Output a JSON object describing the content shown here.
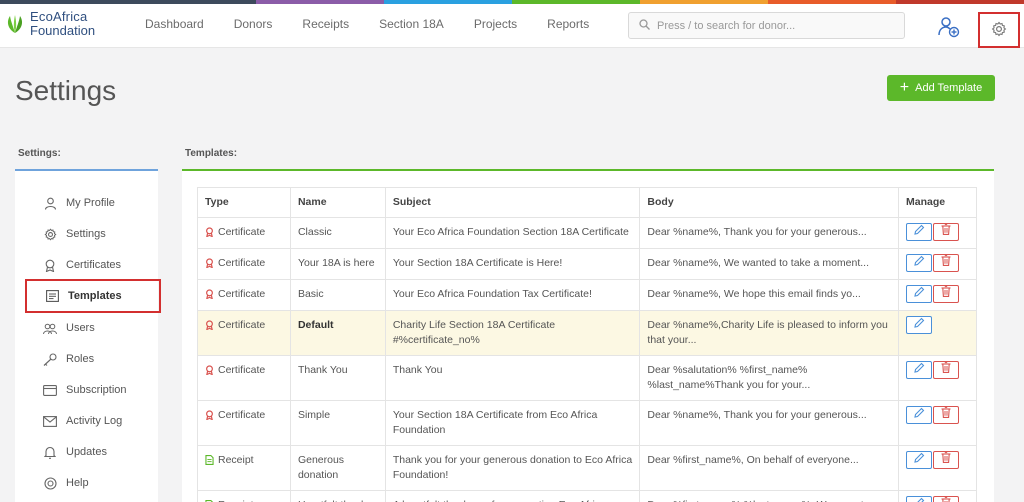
{
  "brand": {
    "line1": "EcoAfrica",
    "line2": "Foundation",
    "stripe_colors": [
      "#3d4a5c",
      "#8b5ca8",
      "#2aa0e0",
      "#5cb82a",
      "#f0a030",
      "#e85c2a",
      "#c0392b"
    ]
  },
  "nav": [
    "Dashboard",
    "Donors",
    "Receipts",
    "Section 18A",
    "Projects",
    "Reports"
  ],
  "search": {
    "placeholder": "Press / to search for donor..."
  },
  "page": {
    "title": "Settings",
    "add_button": "Add Template"
  },
  "sidebar": {
    "heading": "Settings:",
    "items": [
      {
        "label": "My Profile",
        "icon": "user-icon"
      },
      {
        "label": "Settings",
        "icon": "gear-icon"
      },
      {
        "label": "Certificates",
        "icon": "ribbon-icon"
      },
      {
        "label": "Templates",
        "icon": "template-icon"
      },
      {
        "label": "Users",
        "icon": "users-icon"
      },
      {
        "label": "Roles",
        "icon": "key-icon"
      },
      {
        "label": "Subscription",
        "icon": "card-icon"
      },
      {
        "label": "Activity Log",
        "icon": "mail-icon"
      },
      {
        "label": "Updates",
        "icon": "bell-icon"
      },
      {
        "label": "Help",
        "icon": "lifebuoy-icon"
      }
    ]
  },
  "templates": {
    "heading": "Templates:",
    "columns": [
      "Type",
      "Name",
      "Subject",
      "Body",
      "Manage"
    ],
    "rows": [
      {
        "type": "Certificate",
        "name": "Classic",
        "subject": "Your Eco Africa Foundation Section 18A Certificate",
        "body": "Dear %name%, Thank you for your generous...",
        "deletable": true
      },
      {
        "type": "Certificate",
        "name": "Your 18A is here",
        "subject": "Your Section 18A Certificate is Here!",
        "body": "Dear %name%, We wanted to take a moment...",
        "deletable": true
      },
      {
        "type": "Certificate",
        "name": "Basic",
        "subject": "Your Eco Africa Foundation Tax Certificate!",
        "body": "Dear %name%, We hope this email finds yo...",
        "deletable": true
      },
      {
        "type": "Certificate",
        "name": "Default",
        "subject": "Charity Life Section 18A Certificate #%certificate_no%",
        "body": "Dear %name%,Charity Life is pleased to inform you that your...",
        "deletable": false
      },
      {
        "type": "Certificate",
        "name": "Thank You",
        "subject": "Thank You",
        "body": "Dear %salutation% %first_name% %last_name%Thank you for your...",
        "deletable": true
      },
      {
        "type": "Certificate",
        "name": "Simple",
        "subject": "Your Section 18A Certificate from Eco Africa Foundation",
        "body": "Dear %name%, Thank you for your generous...",
        "deletable": true
      },
      {
        "type": "Receipt",
        "name": "Generous donation",
        "subject": "Thank you for your generous donation to Eco Africa Foundation!",
        "body": "Dear %first_name%, On behalf of everyone...",
        "deletable": true
      },
      {
        "type": "Receipt",
        "name": "Heartfelt thank",
        "subject": "A heartfelt thank you for supporting Eco Africa",
        "body": "Dear %first_name% %last_name%, We were t...",
        "deletable": true
      }
    ]
  }
}
